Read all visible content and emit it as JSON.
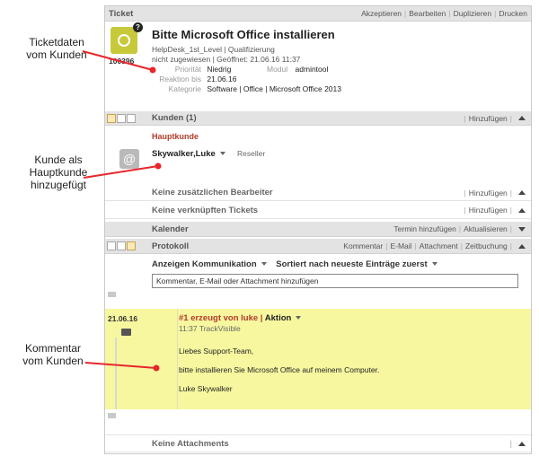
{
  "callouts": {
    "c1": "Ticketdaten vom Kunden",
    "c2": "Kunde als Hauptkunde hinzugefügt",
    "c3": "Kommentar vom Kunden"
  },
  "ticket": {
    "bar_title": "Ticket",
    "actions": [
      "Akzeptieren",
      "Bearbeiten",
      "Duplizieren",
      "Drucken"
    ],
    "id": "100396",
    "title": "Bitte Microsoft Office installieren",
    "line1": "HelpDesk_1st_Level | Qualifizierung",
    "line2": "nicht zugewiesen | Geöffnet: 21.06.16 11:37",
    "prioritaet_label": "Priorität",
    "prioritaet": "Niedrig",
    "modul_label": "Modul",
    "modul": "admintool",
    "reaktion_label": "Reaktion bis",
    "reaktion": "21.06.16",
    "kategorie_label": "Kategorie",
    "kategorie": "Software | Office | Microsoft Office 2013"
  },
  "kunden": {
    "title": "Kunden (1)",
    "add": "Hinzufügen",
    "hauptkunde_label": "Hauptkunde",
    "name": "Skywalker,Luke",
    "role": "Reseller"
  },
  "bearbeiter": {
    "title": "Keine zusätzlichen Bearbeiter",
    "add": "Hinzufügen"
  },
  "verknuepft": {
    "title": "Keine verknüpften Tickets",
    "add": "Hinzufügen"
  },
  "kalender": {
    "title": "Kalender",
    "actions": [
      "Termin hinzufügen",
      "Aktualisieren"
    ]
  },
  "protokoll": {
    "title": "Protokoll",
    "actions": [
      "Kommentar",
      "E-Mail",
      "Attachment",
      "Zeitbuchung"
    ],
    "filter_show": "Anzeigen Kommunikation",
    "filter_sort": "Sortiert nach neueste Einträge zuerst",
    "input_value": "Kommentar, E-Mail oder Attachment hinzufügen",
    "entry": {
      "date": "21.06.16",
      "head": "#1 erzeugt von luke | ",
      "head_action": "Aktion",
      "time": "11:37 TrackVisible",
      "greeting": "Liebes Support-Team,",
      "body": "bitte installieren Sie Microsoft Office auf meinem Computer.",
      "signature": "Luke Skywalker"
    }
  },
  "attachments": {
    "title": "Keine Attachments"
  },
  "colors": {
    "highlight": "#f7f7a0",
    "accent_red": "#b33a2a",
    "arrow": "#e8262b"
  },
  "icons": [
    "ticket-mouse-icon",
    "help-icon",
    "at-icon",
    "camera-icon",
    "chevron-up-icon",
    "chevron-down-icon"
  ]
}
